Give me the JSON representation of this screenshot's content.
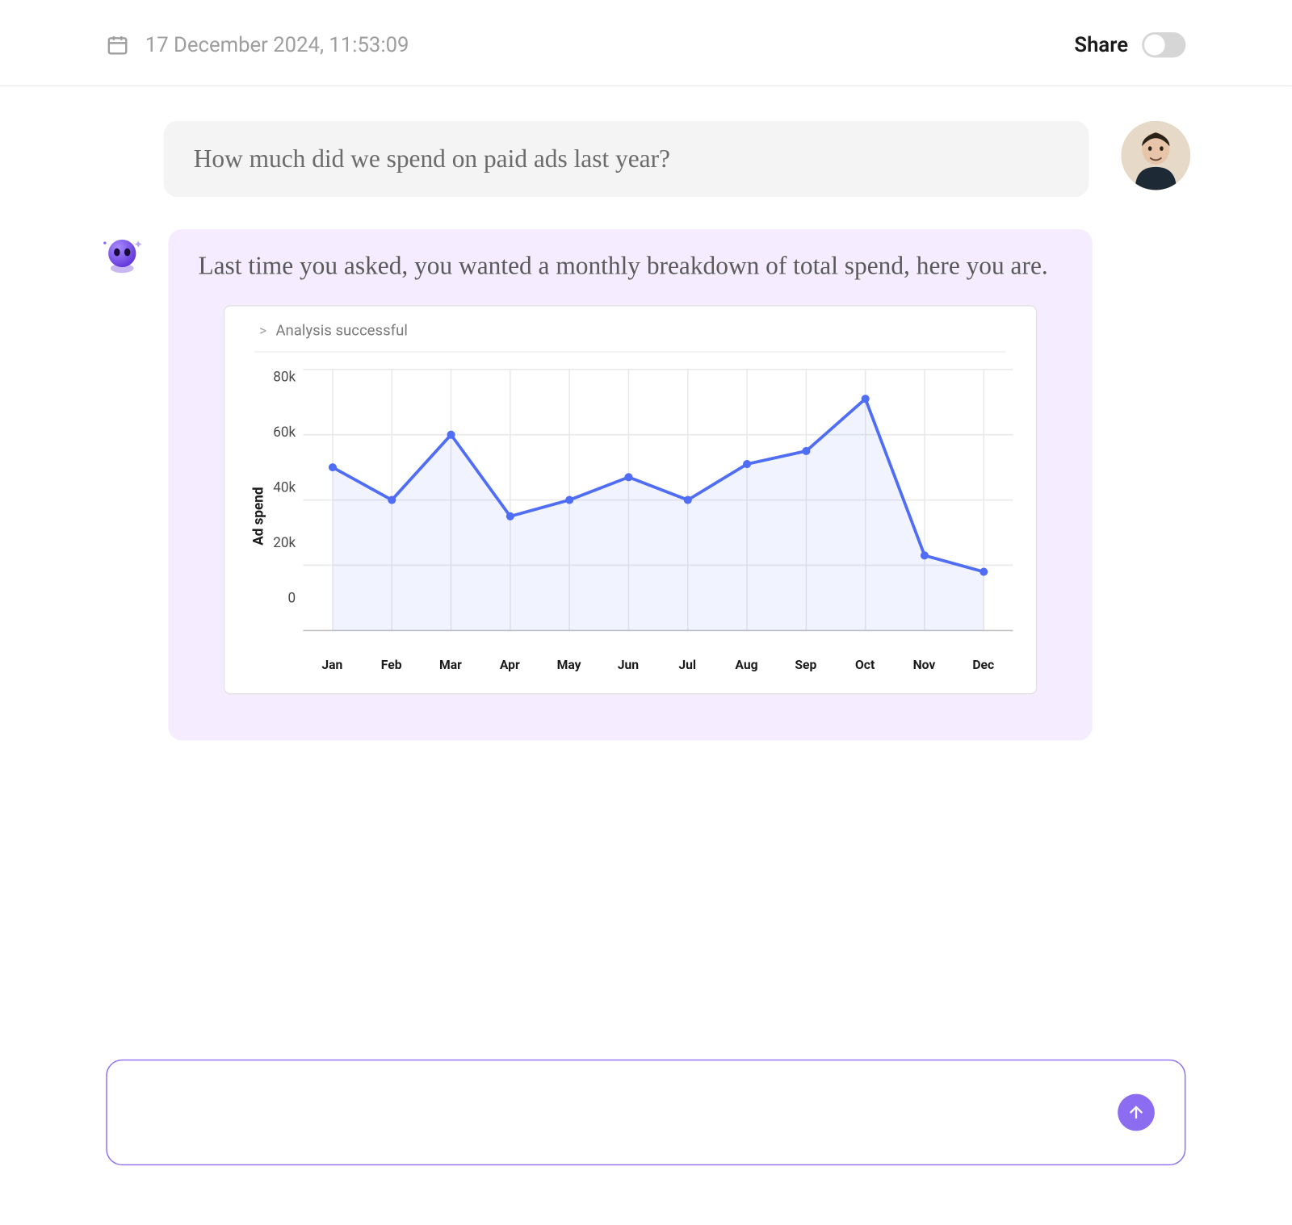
{
  "header": {
    "timestamp": "17 December 2024, 11:53:09",
    "share_label": "Share",
    "share_on": false
  },
  "chat": {
    "user_message": "How much did we spend on paid ads last year?",
    "ai_message": "Last time you asked, you wanted a monthly breakdown of total spend, here you are."
  },
  "chart_status": "Analysis successful",
  "chart_data": {
    "type": "line",
    "title": "",
    "xlabel": "",
    "ylabel": "Ad spend",
    "ylim": [
      0,
      80000
    ],
    "yticks_labels": [
      "80k",
      "60k",
      "40k",
      "20k",
      "0"
    ],
    "yticks_values": [
      80000,
      60000,
      40000,
      20000,
      0
    ],
    "categories": [
      "Jan",
      "Feb",
      "Mar",
      "Apr",
      "May",
      "Jun",
      "Jul",
      "Aug",
      "Sep",
      "Oct",
      "Nov",
      "Dec"
    ],
    "values": [
      50000,
      40000,
      60000,
      35000,
      40000,
      47000,
      40000,
      51000,
      55000,
      71000,
      23000,
      18000
    ]
  },
  "colors": {
    "line": "#4f6df5",
    "area": "rgba(79,109,245,0.08)",
    "grid": "#e9e9eb",
    "accent": "#8c6cf0"
  },
  "input": {
    "placeholder": ""
  }
}
